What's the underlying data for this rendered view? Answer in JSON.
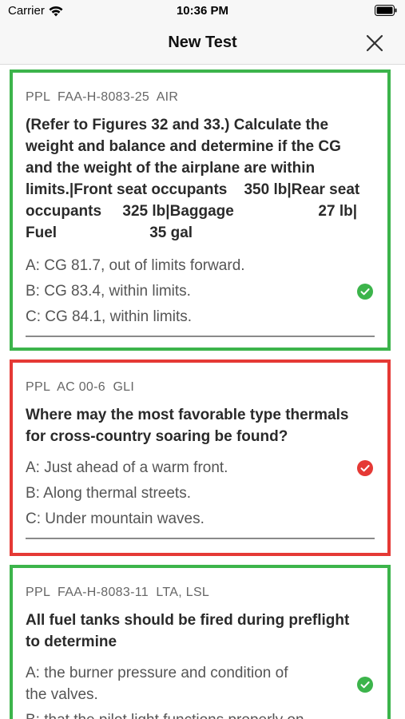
{
  "status": {
    "carrier": "Carrier",
    "time": "10:36 PM"
  },
  "nav": {
    "title": "New Test"
  },
  "cards": [
    {
      "meta": "PPL  FAA-H-8083-25  AIR",
      "question": "(Refer to Figures 32 and 33.) Calculate the weight and balance and determine if the CG and the weight of the airplane are within limits.|Front seat occupants   350 lb|Rear seat occupants   325 lb|Baggage   27 lb|Fuel   35 gal",
      "q_lines": [
        "(Refer to Figures 32 and 33.) Calculate the",
        "weight and balance and determine if the CG",
        "and the weight of the airplane are within",
        "limits.|Front seat occupants    350 lb|Rear seat",
        "occupants     325 lb|Baggage                    27 lb|",
        "Fuel                      35 gal"
      ],
      "answers": [
        "A: CG 81.7, out of limits forward.",
        "B: CG 83.4, within limits.",
        "C: CG 84.1, within limits."
      ],
      "result": "correct",
      "border_color": "#3cb44b"
    },
    {
      "meta": "PPL  AC 00-6  GLI",
      "q_lines": [
        "Where may the most favorable type thermals",
        "for cross-country soaring be found?"
      ],
      "answers": [
        "A: Just ahead of a warm front.",
        "B: Along thermal streets.",
        "C: Under mountain waves."
      ],
      "result": "wrong",
      "border_color": "#e53935"
    },
    {
      "meta": "PPL  FAA-H-8083-11  LTA, LSL",
      "q_lines": [
        "All fuel tanks should be fired during preflight",
        "to determine"
      ],
      "answers": [
        "A: the burner pressure and condition of",
        "the valves.",
        "B: that the pilot light functions properly on"
      ],
      "result": "correct",
      "border_color": "#3cb44b"
    }
  ],
  "colors": {
    "correct": "#3cb44b",
    "wrong": "#e53935"
  },
  "icons": {
    "wifi": "wifi-icon",
    "battery": "battery-icon",
    "close": "close-icon",
    "correct": "check-circle-icon",
    "wrong": "check-circle-icon"
  }
}
